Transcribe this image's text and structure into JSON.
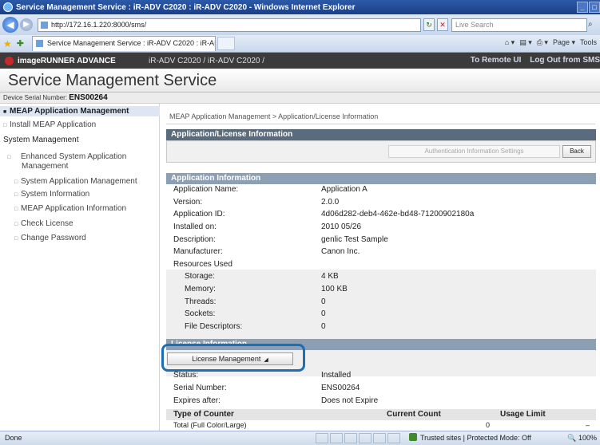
{
  "window": {
    "title": "Service Management Service : iR-ADV C2020 : iR-ADV C2020 - Windows Internet Explorer",
    "url": "http://172.16.1.220:8000/sms/",
    "search_placeholder": "Live Search",
    "tab_label": "Service Management Service : iR-ADV C2020 : iR-ADV...",
    "tools": [
      "Page ▾",
      "Tools"
    ]
  },
  "header": {
    "brand": "imageRUNNER ADVANCE",
    "device": "iR-ADV C2020 / iR-ADV C2020 /",
    "remote_ui": "To Remote UI",
    "logout": "Log Out from SMS",
    "service_title": "Service Management Service",
    "serial_label": "Device Serial Number:",
    "serial_value": "ENS00264"
  },
  "sidebar": {
    "items": [
      {
        "label": "MEAP Application Management"
      },
      {
        "label": "Install MEAP Application"
      },
      {
        "label": "System Management"
      },
      {
        "label": "Enhanced System Application Management"
      },
      {
        "label": "System Application Management"
      },
      {
        "label": "System Information"
      },
      {
        "label": "MEAP Application Information"
      },
      {
        "label": "Check License"
      },
      {
        "label": "Change Password"
      }
    ]
  },
  "main": {
    "breadcrumb": "MEAP Application Management > Application/License Information",
    "section_title": "Application/License Information",
    "auth_button": "Authentication Information Settings",
    "back_button": "Back",
    "app_info_title": "Application Information",
    "app_info": [
      {
        "label": "Application Name:",
        "value": "Application A"
      },
      {
        "label": "Version:",
        "value": "2.0.0"
      },
      {
        "label": "Application ID:",
        "value": "4d06d282-deb4-462e-bd48-71200902180a"
      },
      {
        "label": "Installed on:",
        "value": "2010 05/26"
      },
      {
        "label": "Description:",
        "value": "genlic Test Sample"
      },
      {
        "label": "Manufacturer:",
        "value": "Canon Inc."
      },
      {
        "label": "Resources Used",
        "value": ""
      }
    ],
    "resources": [
      {
        "label": "Storage:",
        "value": "4 KB"
      },
      {
        "label": "Memory:",
        "value": "100 KB"
      },
      {
        "label": "Threads:",
        "value": "0"
      },
      {
        "label": "Sockets:",
        "value": "0"
      },
      {
        "label": "File Descriptors:",
        "value": "0"
      }
    ],
    "license_title": "License Information",
    "license_button": "License Management",
    "license_info": [
      {
        "label": "Status:",
        "value": "Installed"
      },
      {
        "label": "Serial Number:",
        "value": "ENS00264"
      },
      {
        "label": "Expires after:",
        "value": "Does not Expire"
      }
    ],
    "counter_headers": [
      "Type of Counter",
      "Current Count",
      "Usage Limit"
    ],
    "counter_rows": [
      {
        "type": "Total (Full Color/Large)",
        "count": "0",
        "limit": "–"
      }
    ]
  },
  "statusbar": {
    "left": "Done",
    "zone": "Trusted sites | Protected Mode: Off",
    "zoom": "100%"
  },
  "colors": {
    "accent_highlight": "#1d6fb4",
    "section_header": "#8d9fb2",
    "canon_header": "#3b3b3b"
  }
}
